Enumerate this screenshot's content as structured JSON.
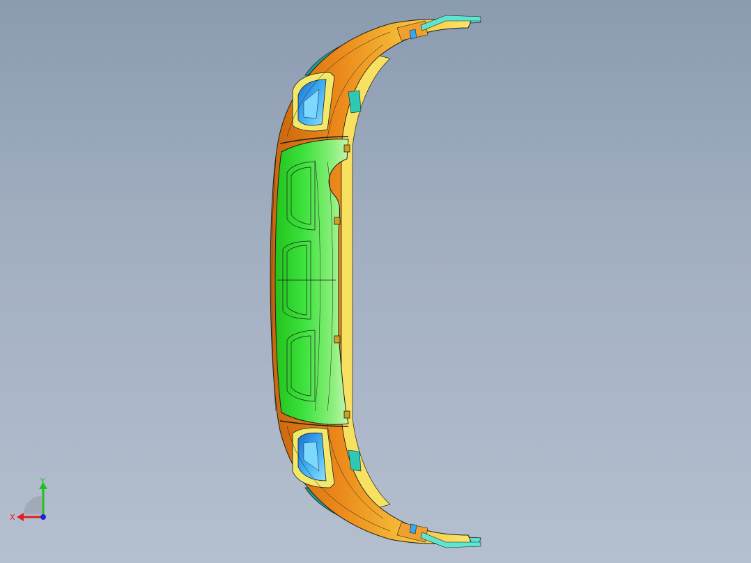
{
  "view": {
    "background_top": "#8b9bb0",
    "background_bottom": "#b4bfcf"
  },
  "model": {
    "name": "",
    "colors": {
      "center_face": "#3ee23e",
      "center_face_light": "#9af08a",
      "side_face": "#e8881a",
      "side_face_light": "#f5d040",
      "flange": "#2ec9b5",
      "vent_glass": "#36a8f0",
      "vent_frame": "#f2e86a",
      "edge_lines": "#1c1c1c",
      "clip": "#d0a020"
    }
  },
  "triad": {
    "x_label": "X",
    "y_label": "Y",
    "x_color": "#e02020",
    "y_color": "#20c020",
    "z_color": "#2020e0"
  }
}
